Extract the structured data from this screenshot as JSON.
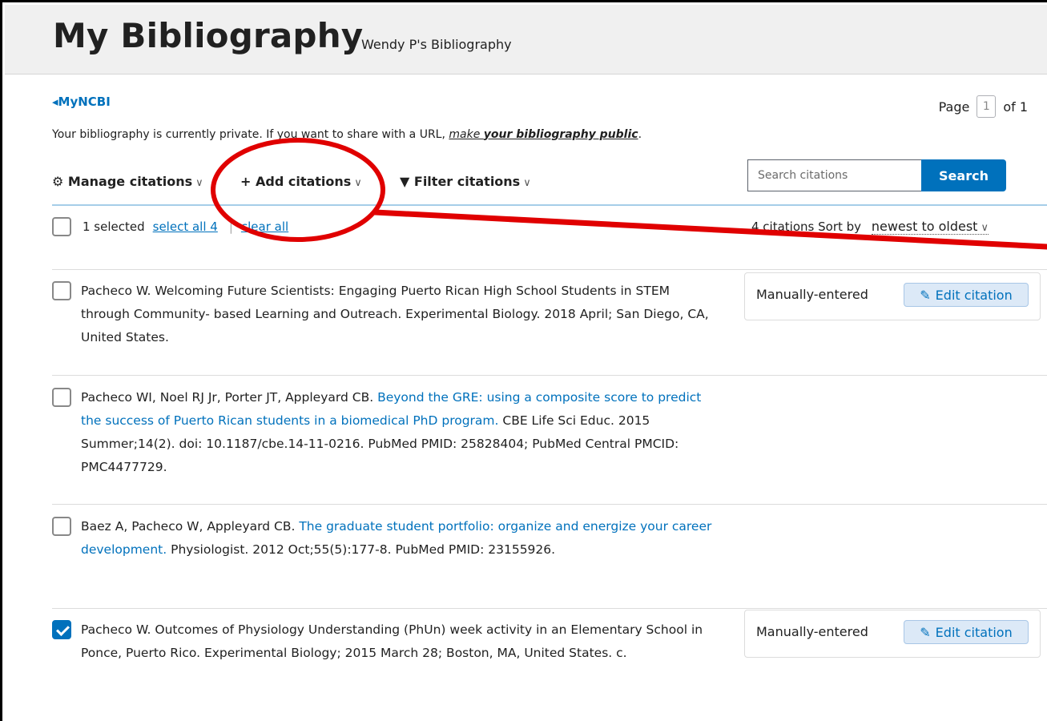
{
  "header": {
    "title": "My Bibliography",
    "subtitle": "Wendy P's Bibliography"
  },
  "nav": {
    "back_link": "MyNCBI"
  },
  "pager": {
    "prefix": "Page",
    "current": "1",
    "suffix": "of 1"
  },
  "privacy": {
    "text": "Your bibliography is currently private. If you want to share with a URL, ",
    "link_part1": "make ",
    "link_part2": "your bibliography public",
    "link_end": "."
  },
  "toolbar": {
    "manage": "Manage citations",
    "add": "Add citations",
    "filter": "Filter citations"
  },
  "search": {
    "placeholder": "Search citations",
    "button": "Search"
  },
  "selection": {
    "count": "1 selected",
    "select_all": "select all 4",
    "separator": "|",
    "clear_all": "clear all"
  },
  "sort": {
    "count_label": "4 citations",
    "label": "Sort by",
    "value": "newest to oldest"
  },
  "citations": [
    {
      "checked": false,
      "pre": "Pacheco W. Welcoming Future Scientists: Engaging Puerto Rican High School Students in STEM through Community- based Learning and Outreach. Experimental Biology. 2018 April; San Diego, CA, United States.",
      "link": "",
      "post": "",
      "source": "Manually-entered",
      "edit": "Edit citation"
    },
    {
      "checked": false,
      "pre": "Pacheco WI, Noel RJ Jr, Porter JT, Appleyard CB. ",
      "link": "Beyond the GRE: using a composite score to predict the success of Puerto Rican students in a biomedical PhD program.",
      "post": " CBE Life Sci Educ. 2015 Summer;14(2). doi: 10.1187/cbe.14-11-0216. PubMed PMID: 25828404; PubMed Central PMCID: PMC4477729."
    },
    {
      "checked": false,
      "pre": "Baez A, Pacheco W, Appleyard CB. ",
      "link": "The graduate student portfolio: organize and energize your career development.",
      "post": " Physiologist. 2012 Oct;55(5):177-8. PubMed PMID: 23155926."
    },
    {
      "checked": true,
      "pre": "Pacheco W. Outcomes of Physiology Understanding (PhUn) week activity in an Elementary School in Ponce, Puerto Rico. Experimental Biology; 2015 March 28; Boston, MA, United States. c.",
      "link": "",
      "post": "",
      "source": "Manually-entered",
      "edit": "Edit citation"
    }
  ],
  "colors": {
    "accent": "#0071bc",
    "annotation": "#e00000"
  }
}
